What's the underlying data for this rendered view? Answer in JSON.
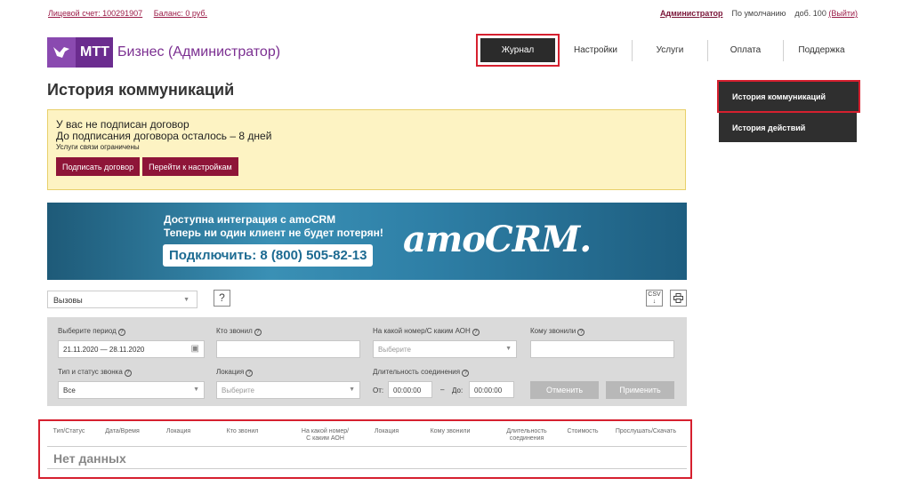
{
  "topbar": {
    "account_label": "Лицевой счет: 100291907",
    "balance_label": "Баланс: 0 руб.",
    "user": "Администратор",
    "default_label": "По умолчанию",
    "ext_label": "доб. 100",
    "exit_label": "(Выйти)"
  },
  "logo": {
    "mtt": "МТТ",
    "text": "Бизнес (Администратор)"
  },
  "nav": {
    "active": "Журнал",
    "items": [
      "Настройки",
      "Услуги",
      "Оплата",
      "Поддержка"
    ]
  },
  "submenu": [
    "История коммуникаций",
    "История действий"
  ],
  "page_title": "История коммуникаций",
  "warning": {
    "line1": "У вас не подписан договор",
    "line2": "До подписания договора осталось – 8 дней",
    "line3": "Услуги связи ограничены",
    "btn_sign": "Подписать договор",
    "btn_settings": "Перейти к настройкам"
  },
  "banner": {
    "line1": "Доступна интеграция с amoCRM",
    "line2": "Теперь ни один клиент не будет потерян!",
    "phone": "Подключить: 8 (800) 505-82-13",
    "logo": "amoCRM."
  },
  "controls": {
    "type_select": "Вызовы",
    "help": "?",
    "csv": "CSV",
    "print_icon": "printer-icon"
  },
  "filter": {
    "period_label": "Выберите период",
    "period_value": "21.11.2020 — 28.11.2020",
    "who_called_label": "Кто звонил",
    "number_label": "На какой номер/С каким АОН",
    "number_placeholder": "Выберите",
    "whom_label": "Кому звонили",
    "type_label": "Тип и статус звонка",
    "type_value": "Все",
    "location_label": "Локация",
    "location_placeholder": "Выберите",
    "duration_label": "Длительность соединения",
    "from_label": "От:",
    "from_value": "00:00:00",
    "dash": "–",
    "to_label": "До:",
    "to_value": "00:00:00",
    "cancel": "Отменить",
    "apply": "Применить"
  },
  "table": {
    "headers": [
      "Тип/Статус",
      "Дата/Время",
      "Локация",
      "Кто звонил",
      "На какой номер/\nС каким АОН",
      "Локация",
      "Кому звонили",
      "Длительность\nсоединения",
      "Стоимость",
      "Прослушать/Скачать"
    ],
    "empty": "Нет данных"
  }
}
